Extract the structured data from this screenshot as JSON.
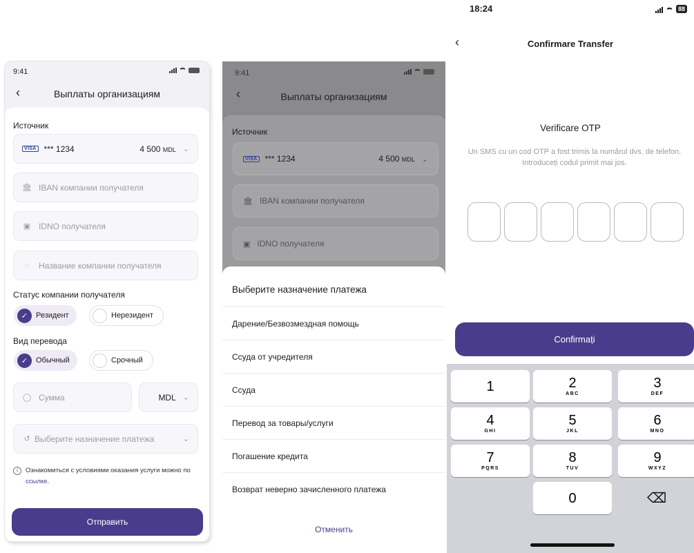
{
  "screen1": {
    "status_time": "9:41",
    "title": "Выплаты организациям",
    "source_label": "Источник",
    "card": {
      "brand": "VISA",
      "masked": "*** 1234",
      "amount": "4 500",
      "currency": "MDL"
    },
    "iban_placeholder": "IBAN компании получателя",
    "idno_placeholder": "IDNO получателя",
    "company_name_placeholder": "Название компании получателя",
    "status_label": "Статус компании получателя",
    "status_options": [
      "Резидент",
      "Нерезидент"
    ],
    "status_selected": "Резидент",
    "transfer_type_label": "Вид перевода",
    "transfer_options": [
      "Обычный",
      "Срочный"
    ],
    "transfer_selected": "Обычный",
    "amount_placeholder": "Сумма",
    "amount_currency": "MDL",
    "purpose_placeholder": "Выберите назначение платежа",
    "note_text": "Ознакомиться с условиями оказания услуги можно по ",
    "note_link": "ссылке",
    "note_end": ".",
    "submit_label": "Отправить"
  },
  "screen2": {
    "status_time": "9:41",
    "title": "Выплаты организациям",
    "source_label": "Источник",
    "card": {
      "brand": "VISA",
      "masked": "*** 1234",
      "amount": "4 500",
      "currency": "MDL"
    },
    "iban_placeholder": "IBAN компании получателя",
    "idno_placeholder": "IDNO получателя",
    "sheet": {
      "title": "Выберите назначение платежа",
      "options": [
        "Дарение/Безвозмездная помощь",
        "Ссуда от учредителя",
        "Ссуда",
        "Перевод за товары/услуги",
        "Погашение кредита",
        "Возврат неверно зачисленного платежа"
      ],
      "cancel_label": "Отменить"
    }
  },
  "screen3": {
    "status_time": "18:24",
    "battery": "88",
    "title": "Confirmare Transfer",
    "otp_title": "Verificare OTP",
    "otp_subtitle": "Un SMS cu un cod OTP a fost trimis la numărul dvs. de telefon. Introduceți codul primit mai jos.",
    "confirm_label": "Confirmați",
    "keys": [
      {
        "digit": "1",
        "letters": ""
      },
      {
        "digit": "2",
        "letters": "ABC"
      },
      {
        "digit": "3",
        "letters": "DEF"
      },
      {
        "digit": "4",
        "letters": "GHI"
      },
      {
        "digit": "5",
        "letters": "JKL"
      },
      {
        "digit": "6",
        "letters": "MNO"
      },
      {
        "digit": "7",
        "letters": "PQRS"
      },
      {
        "digit": "8",
        "letters": "TUV"
      },
      {
        "digit": "9",
        "letters": "WXYZ"
      },
      {
        "digit": "0",
        "letters": ""
      }
    ]
  },
  "colors": {
    "accent": "#4a3c8c",
    "selected_chip": "#eeeaf6",
    "keypad_bg": "#d1d3d9"
  }
}
